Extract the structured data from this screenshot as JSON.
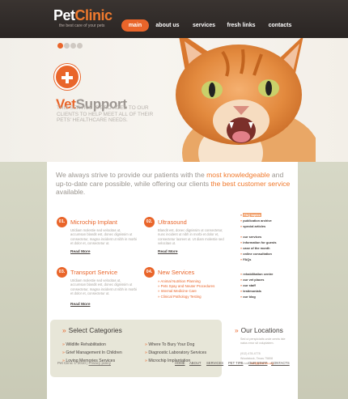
{
  "header": {
    "logo_pet": "Pet",
    "logo_clinic": "Clinic",
    "tagline": "the best care of your pets",
    "nav": [
      "main",
      "about us",
      "services",
      "fresh links",
      "contacts"
    ]
  },
  "hero": {
    "slides": 4,
    "active_slide": 1,
    "title_vet": "Vet",
    "title_support": "Support",
    "text": "THIS SERVICE IS PROVIDED TO OUR CLIENTS TO HELP MEET ALL OF THEIR PETS' HEALTHCARE NEEDS."
  },
  "intro": {
    "part1": "We always strive to provide our patients with the ",
    "hl1": "most knowledgeable",
    "part2": " and  up-to-date care possible, while offering our clients ",
    "hl2": "the best customer service",
    "part3": " available."
  },
  "services": [
    {
      "num": "01.",
      "title": "Microchip Implant",
      "text": "Ut/diam molestie sed velocitas ut, accumsan blandit est, donec dignissim ut consectetur, magna incident ut nibh in morbi et dolor et, consectetur ut.",
      "read_more": "Read More"
    },
    {
      "num": "02.",
      "title": "Ultrasound",
      "text": "Blandit est, donec dignissim ut consectetur, nunc incident ut nibh in morbi et dolor et, consectetur laoreet ut. Ut diam molestie sed velocitas ut.",
      "read_more": "Read More"
    },
    {
      "num": "03.",
      "title": "Transport Service",
      "text": "Ut/diam molestie sed velocitas ut, accumsan blandit est, donec dignissim ut consectetur, magna incident ut nibh in morbi et dolor et, consectetur ut.",
      "read_more": "Read More"
    },
    {
      "num": "04.",
      "title": "New Services",
      "bullets": [
        "Animal Nutrition Planning",
        "Pets Spay and Neuter Procedures",
        "Internal Medicine Care",
        "Clinical Pathology Testing"
      ]
    }
  ],
  "sidebar": [
    "FAQ topics",
    "publication archive",
    "special articles",
    "our services",
    "information for guests",
    "case of the month",
    "online consultation",
    "FAQs",
    "rehabilitation centre",
    "our vet places",
    "our staff",
    "testimonials",
    "our blog"
  ],
  "categories": {
    "title": "Select Categories",
    "items": [
      "Wildlife Rehabilitation",
      "Where To Bury Your Dog",
      "Grief Management In Children",
      "Diagnostic Laboratory Services",
      "Loving Memories Services",
      "Microchip Implantation"
    ]
  },
  "locations": {
    "title": "Our Locations",
    "text": "Sed ut perspiciatis unde omnis iste natus error sit voluptatem.",
    "phone": "(912) 478-4778",
    "address": "Woodstock, Texas 75808",
    "email_label": "E-mail: ",
    "email": "info@petclinic.org"
  },
  "footer": {
    "copyright": "Pet Clinic © 2010 | ",
    "privacy": "Privacy policy",
    "nav": [
      "HOME",
      "ABOUT",
      "SERVICES",
      "PET TIPS",
      "OUR STAFF",
      "CONTACTS"
    ]
  },
  "colors": {
    "accent": "#e9652a",
    "header": "#2e2826",
    "backdrop": "#d3d4c0"
  }
}
